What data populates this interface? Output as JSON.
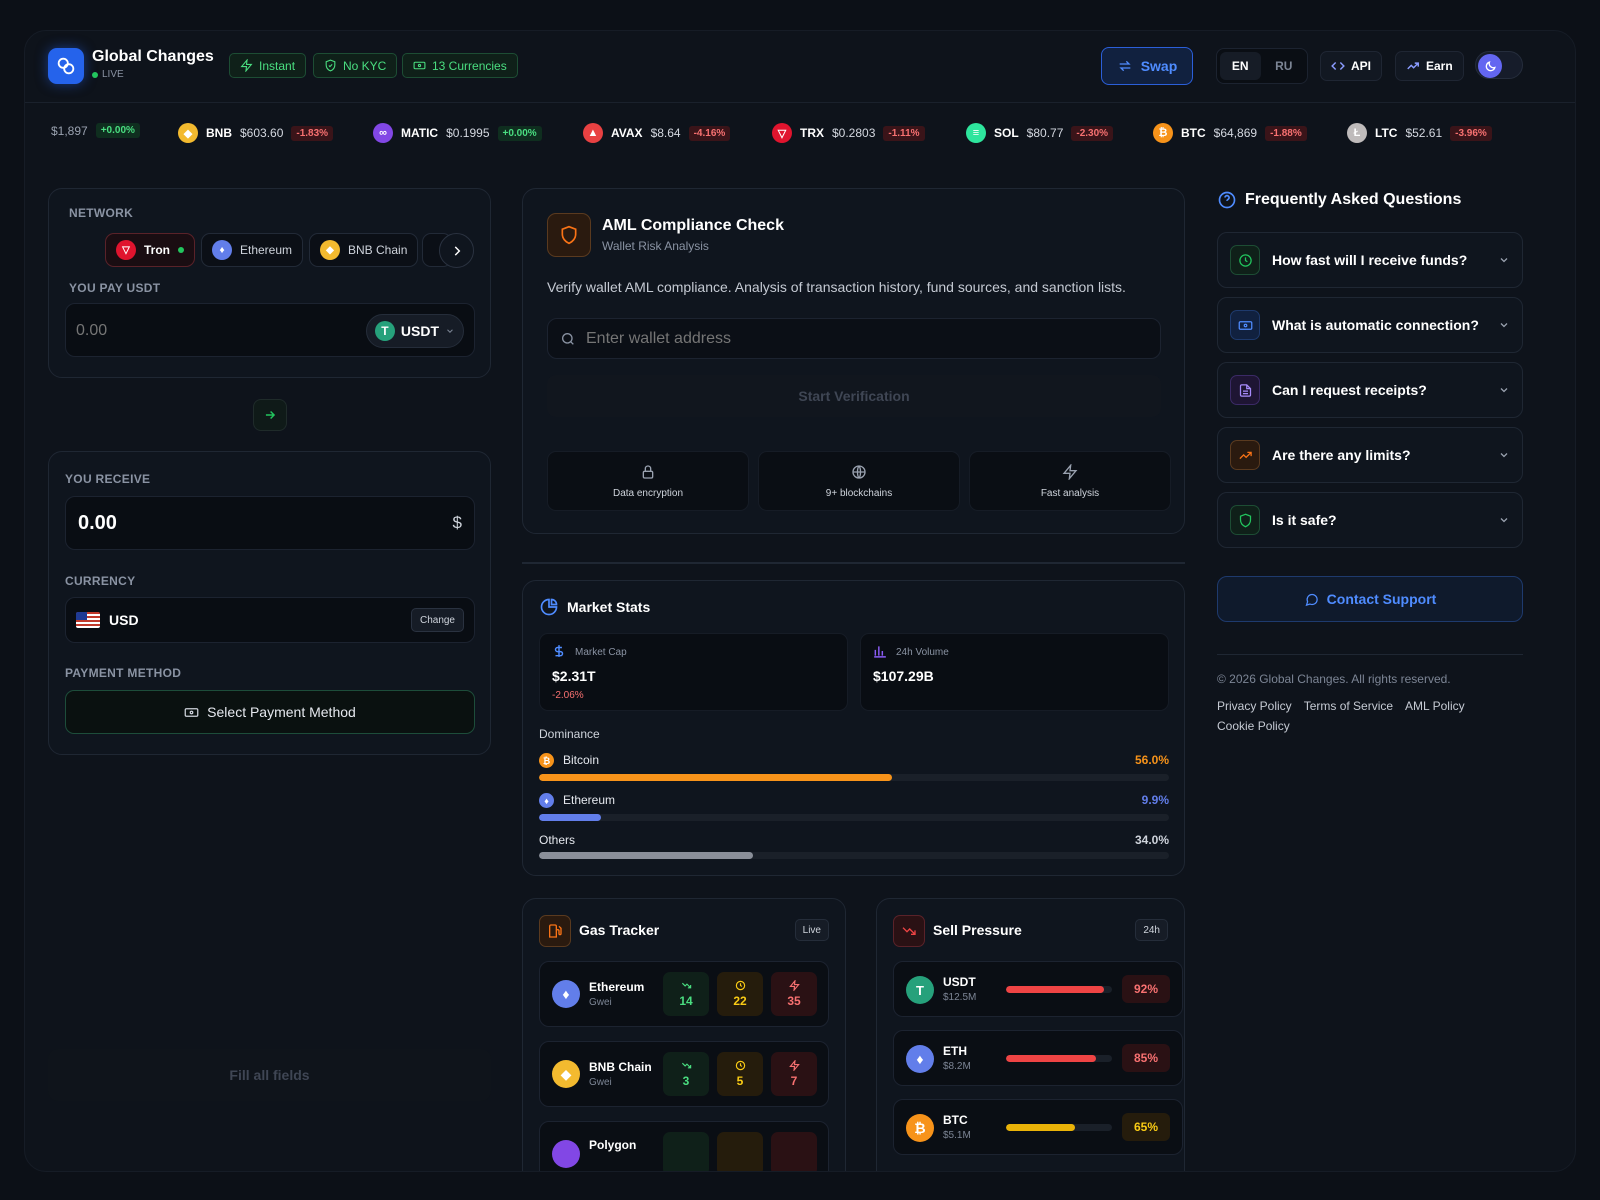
{
  "header": {
    "brand": "Global Changes",
    "status": "LIVE",
    "badges": [
      "Instant",
      "No KYC",
      "13 Currencies"
    ],
    "swap_label": "Swap",
    "languages": [
      "EN",
      "RU"
    ],
    "api_label": "API",
    "earn_label": "Earn"
  },
  "ticker": [
    {
      "symbol": "",
      "price": "$1,897",
      "change": "+0.00%",
      "dir": "pos"
    },
    {
      "symbol": "BNB",
      "price": "$603.60",
      "change": "-1.83%",
      "dir": "neg"
    },
    {
      "symbol": "MATIC",
      "price": "$0.1995",
      "change": "+0.00%",
      "dir": "pos"
    },
    {
      "symbol": "AVAX",
      "price": "$8.64",
      "change": "-4.16%",
      "dir": "neg"
    },
    {
      "symbol": "TRX",
      "price": "$0.2803",
      "change": "-1.11%",
      "dir": "neg"
    },
    {
      "symbol": "SOL",
      "price": "$80.77",
      "change": "-2.30%",
      "dir": "neg"
    },
    {
      "symbol": "BTC",
      "price": "$64,869",
      "change": "-1.88%",
      "dir": "neg"
    },
    {
      "symbol": "LTC",
      "price": "$52.61",
      "change": "-3.96%",
      "dir": "neg"
    }
  ],
  "exchange": {
    "network_label": "NETWORK",
    "networks": [
      "Tron",
      "Ethereum",
      "BNB Chain"
    ],
    "pay_label": "YOU PAY USDT",
    "pay_placeholder": "0.00",
    "pay_currency": "USDT",
    "receive_label": "YOU RECEIVE",
    "receive_value": "0.00",
    "receive_symbol": "$",
    "currency_label": "CURRENCY",
    "currency_value": "USD",
    "change_label": "Change",
    "payment_label": "PAYMENT METHOD",
    "payment_button": "Select Payment Method",
    "submit_label": "Fill all fields"
  },
  "aml": {
    "title": "AML Compliance Check",
    "subtitle": "Wallet Risk Analysis",
    "description": "Verify wallet AML compliance. Analysis of transaction history, fund sources, and sanction lists.",
    "placeholder": "Enter wallet address",
    "button": "Start Verification",
    "features": [
      "Data encryption",
      "9+ blockchains",
      "Fast analysis"
    ]
  },
  "market": {
    "title": "Market Stats",
    "cap_label": "Market Cap",
    "cap_value": "$2.31T",
    "cap_change": "-2.06%",
    "vol_label": "24h Volume",
    "vol_value": "$107.29B",
    "dominance_label": "Dominance",
    "dominance": [
      {
        "name": "Bitcoin",
        "pct": "56.0%",
        "value": 56.0,
        "color": "#f7931a"
      },
      {
        "name": "Ethereum",
        "pct": "9.9%",
        "value": 9.9,
        "color": "#627eea"
      },
      {
        "name": "Others",
        "pct": "34.0%",
        "value": 34.0,
        "color": "#8a8f99"
      }
    ]
  },
  "gas": {
    "title": "Gas Tracker",
    "badge": "Live",
    "rows": [
      {
        "name": "Ethereum",
        "unit": "Gwei",
        "low": "14",
        "avg": "22",
        "high": "35"
      },
      {
        "name": "BNB Chain",
        "unit": "Gwei",
        "low": "3",
        "avg": "5",
        "high": "7"
      },
      {
        "name": "Polygon",
        "unit": "",
        "low": "",
        "avg": "",
        "high": ""
      }
    ]
  },
  "sell": {
    "title": "Sell Pressure",
    "badge": "24h",
    "rows": [
      {
        "name": "USDT",
        "amount": "$12.5M",
        "pct": "92%",
        "value": 92,
        "color": "#ef4444"
      },
      {
        "name": "ETH",
        "amount": "$8.2M",
        "pct": "85%",
        "value": 85,
        "color": "#ef4444"
      },
      {
        "name": "BTC",
        "amount": "$5.1M",
        "pct": "65%",
        "value": 65,
        "color": "#eab308"
      }
    ]
  },
  "faq": {
    "title": "Frequently Asked Questions",
    "items": [
      "How fast will I receive funds?",
      "What is automatic connection?",
      "Can I request receipts?",
      "Are there any limits?",
      "Is it safe?"
    ],
    "contact": "Contact Support"
  },
  "footer": {
    "copyright": "© 2026 Global Changes. All rights reserved.",
    "links": [
      "Privacy Policy",
      "Terms of Service",
      "AML Policy",
      "Cookie Policy"
    ]
  }
}
